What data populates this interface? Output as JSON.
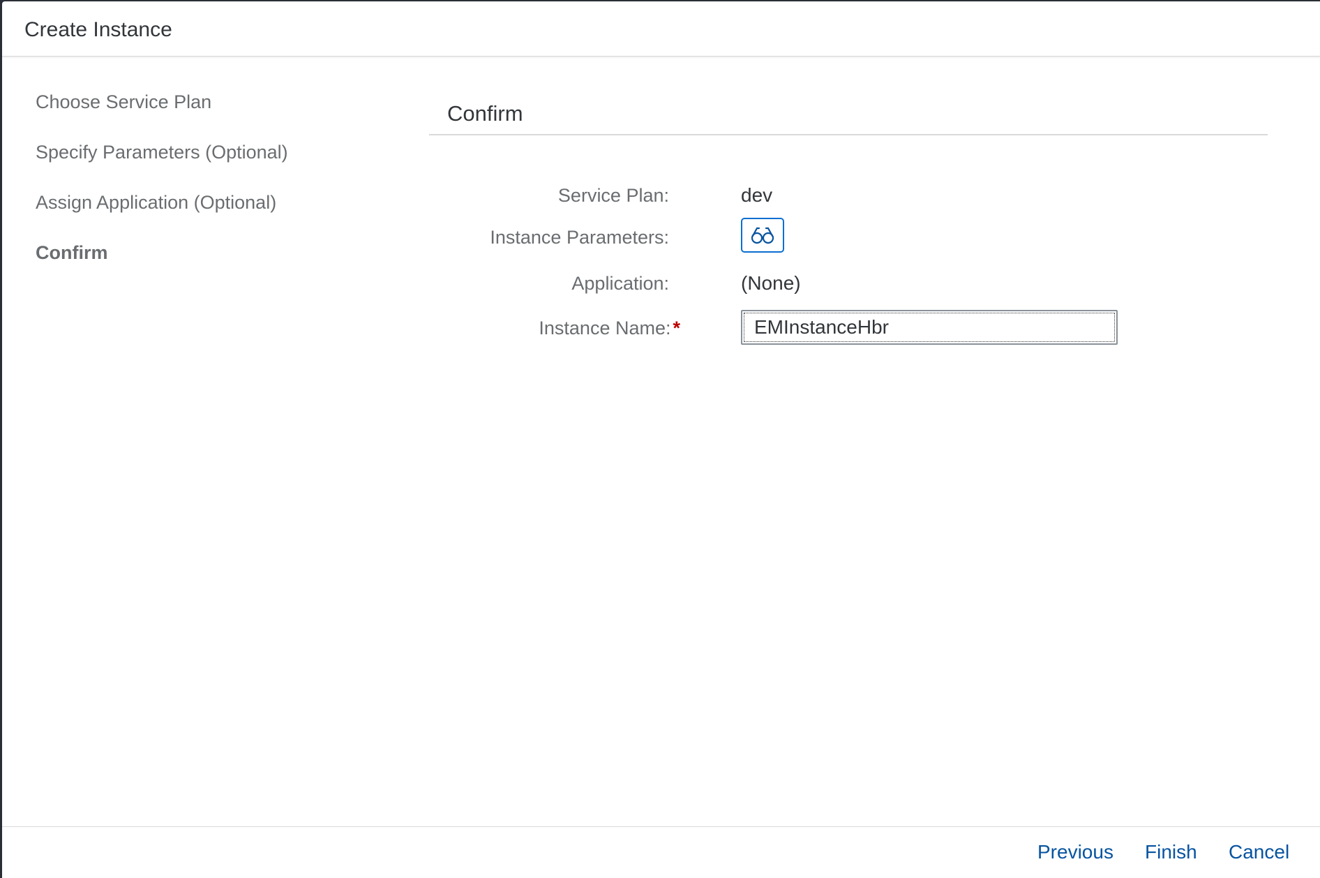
{
  "dialog": {
    "title": "Create Instance"
  },
  "steps": [
    {
      "label": "Choose Service Plan",
      "active": false
    },
    {
      "label": "Specify Parameters (Optional)",
      "active": false
    },
    {
      "label": "Assign Application (Optional)",
      "active": false
    },
    {
      "label": "Confirm",
      "active": true
    }
  ],
  "confirm": {
    "section_title": "Confirm",
    "service_plan_label": "Service Plan:",
    "service_plan_value": "dev",
    "instance_parameters_label": "Instance Parameters:",
    "instance_parameters_icon": "glasses-icon",
    "application_label": "Application:",
    "application_value": "(None)",
    "instance_name_label": "Instance Name:",
    "instance_name_required": "*",
    "instance_name_value": "EMInstanceHbr"
  },
  "footer": {
    "previous_label": "Previous",
    "finish_label": "Finish",
    "cancel_label": "Cancel"
  },
  "colors": {
    "accent": "#0854a0",
    "required": "#bb0000",
    "label": "#6a6d70",
    "text": "#32363a"
  }
}
